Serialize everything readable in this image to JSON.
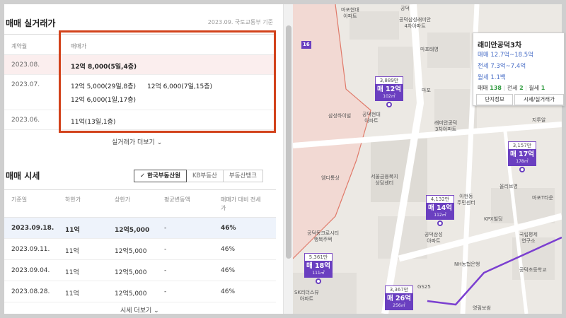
{
  "trade": {
    "title": "매매 실거래가",
    "basis": "2023.09. 국토교통부 기준",
    "col_month": "계약월",
    "col_price": "매매가",
    "rows": [
      {
        "month": "2023.08.",
        "prices": [
          "12억 8,000(5일,4층)"
        ]
      },
      {
        "month": "2023.07.",
        "prices": [
          "12억 5,000(29일,8층)",
          "12억 6,000(7일,15층)",
          "12억 6,000(1일,17층)"
        ]
      },
      {
        "month": "2023.06.",
        "prices": [
          "11억(13일,1층)"
        ]
      }
    ],
    "more": "실거래가 더보기"
  },
  "market": {
    "title": "매매 시세",
    "tabs": [
      "한국부동산원",
      "KB부동산",
      "부동산뱅크"
    ],
    "cols": [
      "기준일",
      "하한가",
      "상한가",
      "평균변동액",
      "매매가 대비 전세",
      "가"
    ],
    "rows": [
      {
        "date": "2023.09.18.",
        "low": "11억",
        "high": "12억5,000",
        "change": "-",
        "ratio": "46%"
      },
      {
        "date": "2023.09.11.",
        "low": "11억",
        "high": "12억5,000",
        "change": "-",
        "ratio": "46%"
      },
      {
        "date": "2023.09.04.",
        "low": "11억",
        "high": "12억5,000",
        "change": "-",
        "ratio": "46%"
      },
      {
        "date": "2023.08.28.",
        "low": "11억",
        "high": "12억5,000",
        "change": "-",
        "ratio": "46%"
      }
    ],
    "more": "시세 더보기"
  },
  "map": {
    "labels": [
      "마포현대",
      "아파트",
      "공덕삼성래미안",
      "4차아파트",
      "마포태영",
      "삼성하이빌",
      "공덕현대",
      "아파트",
      "래미안공덕",
      "3차아파트",
      "지투알",
      "서울금융복지",
      "상담센터",
      "엠디통상",
      "아현동",
      "주민센터",
      "올리브영",
      "마포T타운",
      "KPX빌딩",
      "공덕동크로시티",
      "행복주택",
      "공덕삼성",
      "아파트",
      "국립평제",
      "연구소",
      "NH농협은행",
      "공덕초등학교",
      "SK리더스뷰",
      "아파트",
      "GS25",
      "영림보쌈",
      "공덕",
      "마포",
      "마포",
      "16"
    ],
    "markers": [
      {
        "price": "3,889만",
        "name": "매 12억",
        "area": "102㎡"
      },
      {
        "price": "3,157만",
        "name": "매 17억",
        "area": "178㎡"
      },
      {
        "price": "4,132만",
        "name": "매 14억",
        "area": "112㎡"
      },
      {
        "price": "5,361만",
        "name": "매 18억",
        "area": "111㎡"
      },
      {
        "price": "3,367만",
        "name": "매 26억",
        "area": "256㎡"
      }
    ],
    "popup": {
      "title": "래미안공덕3차",
      "sale": "매매 12.7억~18.5억",
      "jeonse": "전세 7.3억~7.4억",
      "rent": "월세 1.1백",
      "c_sale_label": "매매",
      "c_sale": "138",
      "c_jeonse_label": "전세",
      "c_jeonse": "2",
      "c_rent_label": "월세",
      "c_rent": "1",
      "btn_info": "단지정보",
      "btn_price": "시세/실거래가"
    }
  },
  "colors": {
    "accent_red": "#d2421b",
    "marker_purple": "#6a3fc0",
    "link_blue": "#4a6fc7"
  }
}
